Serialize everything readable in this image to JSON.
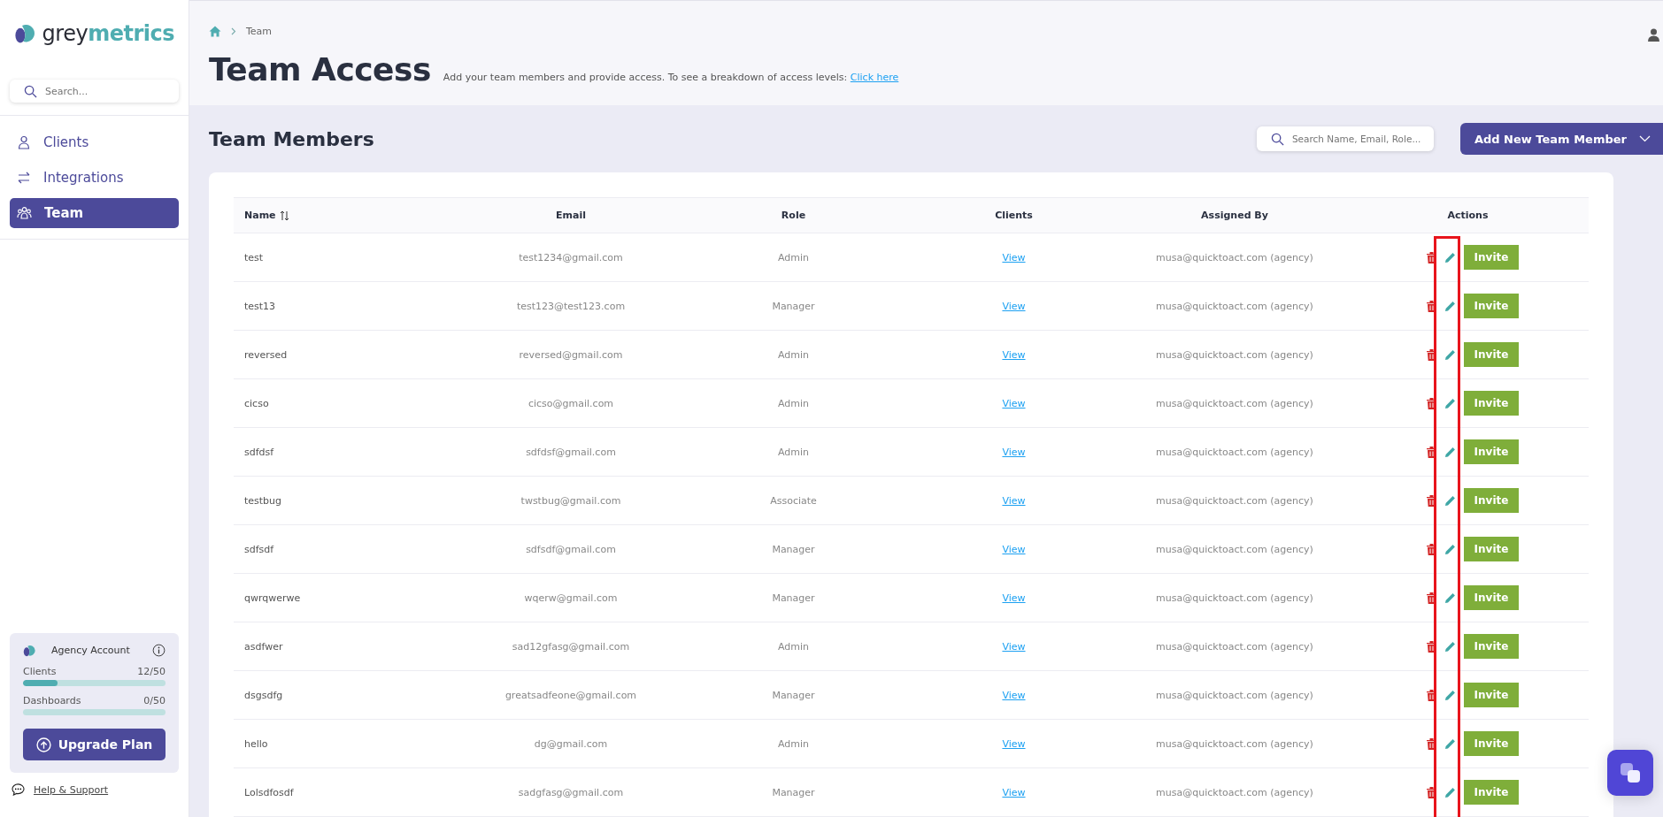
{
  "logo": {
    "part_1": "grey",
    "part_2": "metrics"
  },
  "sidebar": {
    "search": {
      "placeholder": "Search..."
    },
    "items": [
      {
        "label": "Clients",
        "selected": false
      },
      {
        "label": "Integrations",
        "selected": false
      },
      {
        "label": "Team",
        "selected": true
      }
    ],
    "account": {
      "title": "Agency Account",
      "meters": [
        {
          "label": "Clients",
          "reading": "12/50",
          "level": 0.24
        },
        {
          "label": "Dashboards",
          "reading": "0/50",
          "level": 0
        }
      ],
      "upgrade": "Upgrade Plan"
    },
    "help": "Help & Support"
  },
  "breadcrumb": [
    "Team"
  ],
  "page": {
    "title": "Team Access",
    "description": "Add your team members and provide access. To see a breakdown of access levels:",
    "link": "Click here"
  },
  "section": {
    "title": "Team Members",
    "search": {
      "placeholder": "Search Name, Email, Role..."
    },
    "add_button": "Add New Team Member"
  },
  "table": {
    "columns": [
      "Name",
      "Email",
      "Role",
      "Clients",
      "Assigned By",
      "Actions"
    ],
    "rows": [
      {
        "name": "test",
        "email": "test1234@gmail.com",
        "role": "Admin",
        "clients": "View",
        "assigned_by": "musa@quicktoact.com (agency)",
        "action": "Invite"
      },
      {
        "name": "test13",
        "email": "test123@test123.com",
        "role": "Manager",
        "clients": "View",
        "assigned_by": "musa@quicktoact.com (agency)",
        "action": "Invite"
      },
      {
        "name": "reversed",
        "email": "reversed@gmail.com",
        "role": "Admin",
        "clients": "View",
        "assigned_by": "musa@quicktoact.com (agency)",
        "action": "Invite"
      },
      {
        "name": "cicso",
        "email": "cicso@gmail.com",
        "role": "Admin",
        "clients": "View",
        "assigned_by": "musa@quicktoact.com (agency)",
        "action": "Invite"
      },
      {
        "name": "sdfdsf",
        "email": "sdfdsf@gmail.com",
        "role": "Admin",
        "clients": "View",
        "assigned_by": "musa@quicktoact.com (agency)",
        "action": "Invite"
      },
      {
        "name": "testbug",
        "email": "twstbug@gmail.com",
        "role": "Associate",
        "clients": "View",
        "assigned_by": "musa@quicktoact.com (agency)",
        "action": "Invite"
      },
      {
        "name": "sdfsdf",
        "email": "sdfsdf@gmail.com",
        "role": "Manager",
        "clients": "View",
        "assigned_by": "musa@quicktoact.com (agency)",
        "action": "Invite"
      },
      {
        "name": "qwrqwerwe",
        "email": "wqerw@gmail.com",
        "role": "Manager",
        "clients": "View",
        "assigned_by": "musa@quicktoact.com (agency)",
        "action": "Invite"
      },
      {
        "name": "asdfwer",
        "email": "sad12gfasg@gmail.com",
        "role": "Admin",
        "clients": "View",
        "assigned_by": "musa@quicktoact.com (agency)",
        "action": "Invite"
      },
      {
        "name": "dsgsdfg",
        "email": "greatsadfeone@gmail.com",
        "role": "Manager",
        "clients": "View",
        "assigned_by": "musa@quicktoact.com (agency)",
        "action": "Invite"
      },
      {
        "name": "hello",
        "email": "dg@gmail.com",
        "role": "Admin",
        "clients": "View",
        "assigned_by": "musa@quicktoact.com (agency)",
        "action": "Invite"
      },
      {
        "name": "Lolsdfosdf",
        "email": "sadgfasg@gmail.com",
        "role": "Manager",
        "clients": "View",
        "assigned_by": "musa@quicktoact.com (agency)",
        "action": "Invite"
      }
    ]
  }
}
